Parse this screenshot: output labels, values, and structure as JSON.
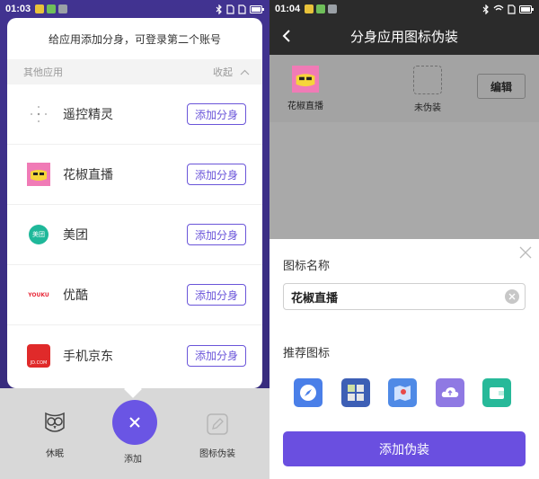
{
  "left": {
    "status": {
      "time": "01:03"
    },
    "popup": {
      "header": "给应用添加分身，可登录第二个账号",
      "section_title": "其他应用",
      "collapse_label": "收起",
      "apps": [
        {
          "name": "遥控精灵",
          "button": "添加分身",
          "icon": "remote-control-app-icon",
          "icon_text": "",
          "color": "#ffffff"
        },
        {
          "name": "花椒直播",
          "button": "添加分身",
          "icon": "huajiao-app-icon",
          "icon_text": "",
          "color": "#f07bb6"
        },
        {
          "name": "美团",
          "button": "添加分身",
          "icon": "meituan-app-icon",
          "icon_text": "美团",
          "color": "#1fb89a"
        },
        {
          "name": "优酷",
          "button": "添加分身",
          "icon": "youku-app-icon",
          "icon_text": "YOUKU",
          "color": "#e82a3a"
        },
        {
          "name": "手机京东",
          "button": "添加分身",
          "icon": "jd-app-icon",
          "icon_text": "JD.COM",
          "color": "#e02a2a"
        }
      ]
    },
    "tabs": {
      "sleep": "休眠",
      "add": "添加",
      "disguise": "图标伪装"
    }
  },
  "right": {
    "status": {
      "time": "01:04"
    },
    "title": "分身应用图标伪装",
    "preview": {
      "original": "花椒直播",
      "disguised": "未伪装",
      "edit": "编辑"
    },
    "sheet": {
      "name_label": "图标名称",
      "name_value": "花椒直播",
      "recommend_label": "推荐图标",
      "recommended_icons": [
        {
          "name": "compass-app-icon",
          "color": "#4a7fe8"
        },
        {
          "name": "calculator-app-icon",
          "color": "#3d5fb5"
        },
        {
          "name": "map-app-icon",
          "color": "#4f8ae6"
        },
        {
          "name": "cloud-app-icon",
          "color": "#8f79e3"
        },
        {
          "name": "wallet-app-icon",
          "color": "#27b999"
        }
      ],
      "submit": "添加伪装"
    }
  },
  "colors": {
    "accent": "#6a55e4",
    "accent_text": "#6a55d9",
    "dark_bar": "#2b2b2b"
  }
}
